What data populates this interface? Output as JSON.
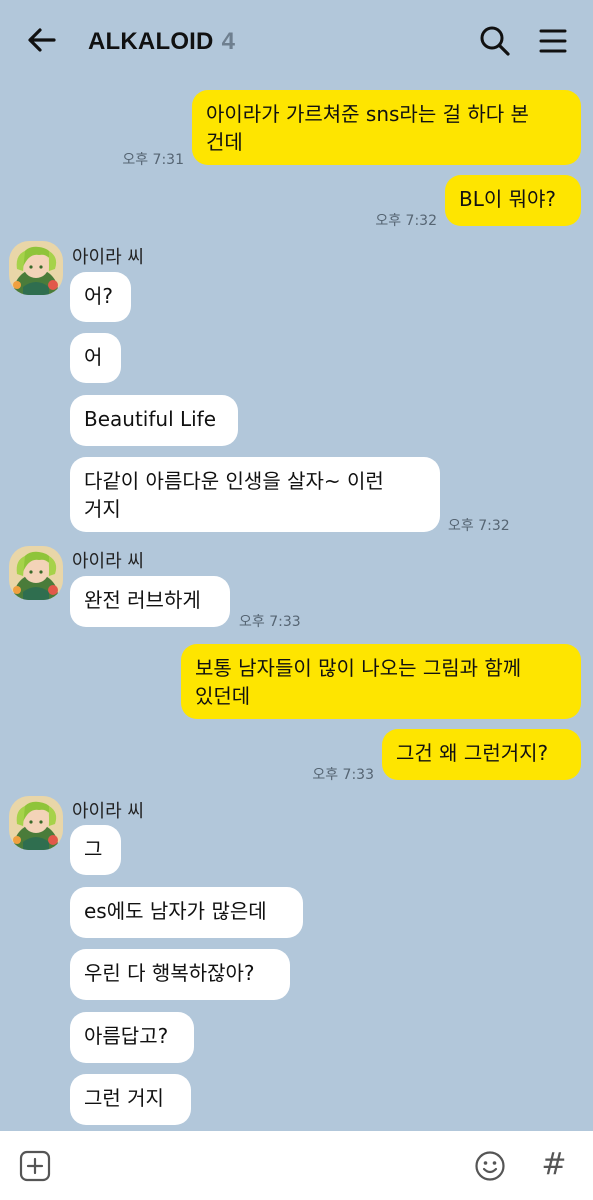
{
  "header": {
    "title": "ALKALOID",
    "member_count": "4",
    "back_icon": "arrow-left-icon",
    "search_icon": "search-icon",
    "menu_icon": "hamburger-menu-icon"
  },
  "colors": {
    "background": "#b2c7da",
    "my_bubble": "#fee500",
    "other_bubble": "#ffffff",
    "timestamp": "#566573"
  },
  "messages": [
    {
      "from": "me",
      "text": "아이라가 가르쳐준 sns라는 걸 하다 본\n건데",
      "time": "오후 7:31"
    },
    {
      "from": "me",
      "text": "BL이 뭐야?",
      "time": "오후 7:32"
    },
    {
      "from": "other",
      "sender": "아이라 씨",
      "text": "어?"
    },
    {
      "from": "other",
      "text": "어"
    },
    {
      "from": "other",
      "text": "Beautiful Life"
    },
    {
      "from": "other",
      "text": "다같이 아름다운 인생을 살자~ 이런\n거지",
      "time": "오후 7:32"
    },
    {
      "from": "other",
      "sender": "아이라 씨",
      "text": "완전 러브하게",
      "time": "오후 7:33"
    },
    {
      "from": "me",
      "text": "보통 남자들이 많이 나오는 그림과 함께\n있던데"
    },
    {
      "from": "me",
      "text": "그건 왜 그런거지?",
      "time": "오후 7:33"
    },
    {
      "from": "other",
      "sender": "아이라 씨",
      "text": "그"
    },
    {
      "from": "other",
      "text": "es에도 남자가 많은데"
    },
    {
      "from": "other",
      "text": "우린 다 행복하잖아?"
    },
    {
      "from": "other",
      "text": "아름답고?"
    },
    {
      "from": "other",
      "text": "그런 거지"
    }
  ],
  "input_bar": {
    "plus_icon": "plus-icon",
    "emoji_icon": "emoji-icon",
    "hashtag_icon": "hashtag-icon",
    "hashtag_glyph": "#"
  }
}
